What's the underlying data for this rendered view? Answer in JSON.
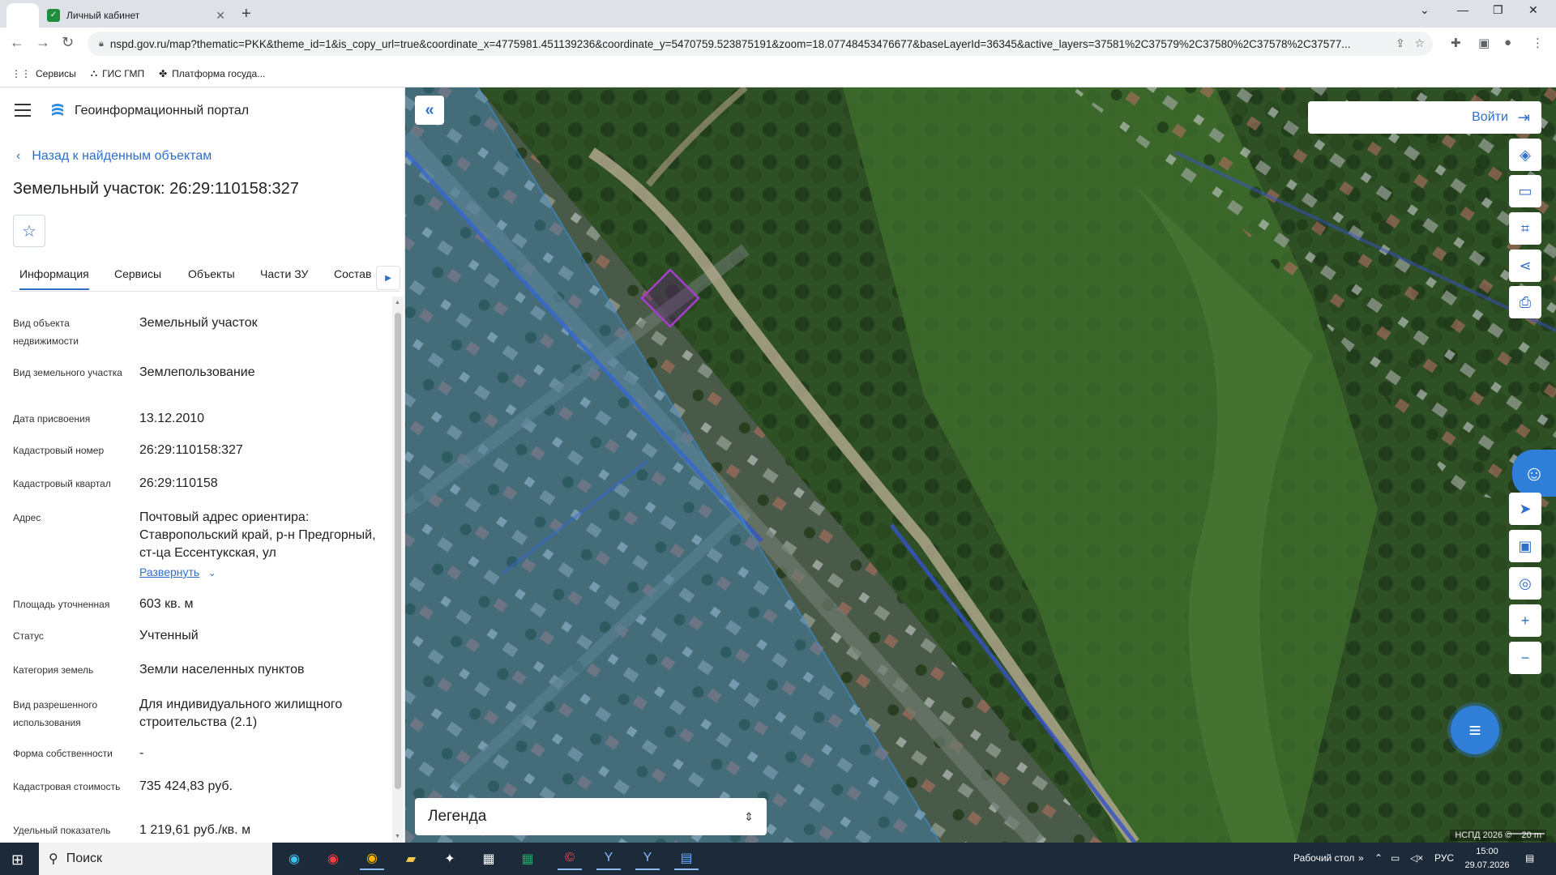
{
  "browser": {
    "tab_title": "Личный кабинет",
    "new_tab": "+",
    "url": "nspd.gov.ru/map?thematic=PKK&theme_id=1&is_copy_url=true&coordinate_x=4775981.451139236&coordinate_y=5470759.523875191&zoom=18.07748453476677&baseLayerId=36345&active_layers=37581%2C37579%2C37580%2C37578%2C37577...",
    "bookmarks": [
      {
        "label": "Сервисы"
      },
      {
        "label": "ГИС ГМП"
      },
      {
        "label": "Платформа госуда..."
      }
    ]
  },
  "panel": {
    "portal_title": "Геоинформационный портал",
    "back_link": "Назад к найденным объектам",
    "parcel_title": "Земельный участок: 26:29:110158:327",
    "tabs": [
      "Информация",
      "Сервисы",
      "Объекты",
      "Части ЗУ",
      "Состав"
    ],
    "fields": {
      "object_type": {
        "label": "Вид объекта недвижимости",
        "value": "Земельный участок"
      },
      "parcel_type": {
        "label": "Вид земельного участка",
        "value": "Землепользование"
      },
      "assign_date": {
        "label": "Дата присвоения",
        "value": "13.12.2010"
      },
      "cadastral_number": {
        "label": "Кадастровый номер",
        "value": "26:29:110158:327"
      },
      "cadastral_quarter": {
        "label": "Кадастровый квартал",
        "value": "26:29:110158"
      },
      "address": {
        "label": "Адрес",
        "value": "Почтовый адрес ориентира: Ставропольский край, р-н Предгорный, ст-ца Ессентукская, ул",
        "expand": "Развернуть"
      },
      "area": {
        "label": "Площадь уточненная",
        "value": "603 кв. м"
      },
      "status": {
        "label": "Статус",
        "value": "Учтенный"
      },
      "category": {
        "label": "Категория земель",
        "value": "Земли населенных пунктов"
      },
      "permitted_use": {
        "label": "Вид разрешенного использования",
        "value": "Для индивидуального жилищного строительства (2.1)"
      },
      "ownership": {
        "label": "Форма собственности",
        "value": "-"
      },
      "cost": {
        "label": "Кадастровая стоимость",
        "value": "735 424,83 руб."
      },
      "specific": {
        "label": "Удельный показатель",
        "value": "1 219,61 руб./кв. м"
      }
    }
  },
  "map": {
    "login": "Войти",
    "legend": "Легенда",
    "attribution": "НСПД 2026 ©",
    "scale": "20 m",
    "colors": {
      "parcel": "#8a2fa8",
      "zone": "#3a8fd6",
      "road": "#3552c9"
    }
  },
  "taskbar": {
    "search": "Поиск",
    "desktop": "Рабочий стол",
    "lang": "РУС",
    "time": "15:00",
    "date": "29.07.2026"
  }
}
